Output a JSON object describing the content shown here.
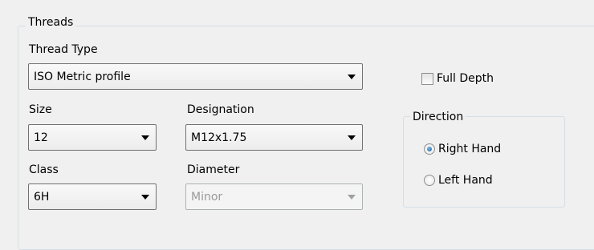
{
  "threads_group": {
    "title": "Threads"
  },
  "thread_type": {
    "label": "Thread Type",
    "selected": "ISO Metric profile"
  },
  "full_depth": {
    "label": "Full Depth",
    "checked": false
  },
  "size": {
    "label": "Size",
    "selected": "12"
  },
  "designation": {
    "label": "Designation",
    "selected": "M12x1.75"
  },
  "class": {
    "label": "Class",
    "selected": "6H"
  },
  "diameter": {
    "label": "Diameter",
    "selected": "Minor",
    "enabled": false
  },
  "direction": {
    "title": "Direction",
    "options": [
      {
        "label": "Right Hand",
        "checked": true
      },
      {
        "label": "Left Hand",
        "checked": false
      }
    ]
  },
  "colors": {
    "background": "#f0f0f0",
    "group_border": "#d5dfe5",
    "disabled_text": "#9a9a9a",
    "radio_selected": "#1f5e9c"
  }
}
